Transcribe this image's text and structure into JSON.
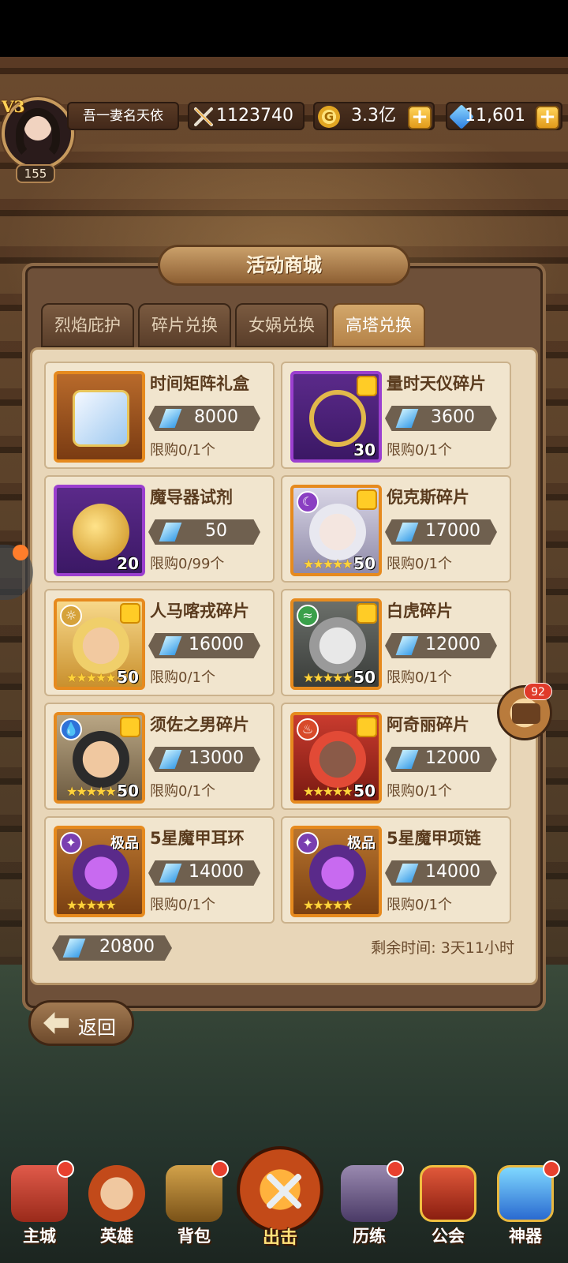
{
  "header": {
    "vip": "V3",
    "level": "155",
    "player_name": "吾一妻名天依",
    "power": "1123740",
    "gold": "3.3亿",
    "gems": "11,601",
    "plus": "+"
  },
  "panel": {
    "title": "活动商城",
    "tabs": [
      {
        "label": "烈焰庇护",
        "active": false
      },
      {
        "label": "碎片兑换",
        "active": false
      },
      {
        "label": "女娲兑换",
        "active": false
      },
      {
        "label": "高塔兑换",
        "active": true
      }
    ],
    "items": [
      {
        "title": "时间矩阵礼盒",
        "price": "8000",
        "limit": "限购0/1个",
        "qty": "",
        "stars": "",
        "quality": ""
      },
      {
        "title": "量时天仪碎片",
        "price": "3600",
        "limit": "限购0/1个",
        "qty": "30",
        "stars": "",
        "quality": ""
      },
      {
        "title": "魔导器试剂",
        "price": "50",
        "limit": "限购0/99个",
        "qty": "20",
        "stars": "",
        "quality": ""
      },
      {
        "title": "倪克斯碎片",
        "price": "17000",
        "limit": "限购0/1个",
        "qty": "50",
        "stars": "★★★★★",
        "quality": ""
      },
      {
        "title": "人马喀戎碎片",
        "price": "16000",
        "limit": "限购0/1个",
        "qty": "50",
        "stars": "★★★★★",
        "quality": ""
      },
      {
        "title": "白虎碎片",
        "price": "12000",
        "limit": "限购0/1个",
        "qty": "50",
        "stars": "★★★★★",
        "quality": ""
      },
      {
        "title": "须佐之男碎片",
        "price": "13000",
        "limit": "限购0/1个",
        "qty": "50",
        "stars": "★★★★★",
        "quality": ""
      },
      {
        "title": "阿奇丽碎片",
        "price": "12000",
        "limit": "限购0/1个",
        "qty": "50",
        "stars": "★★★★★",
        "quality": ""
      },
      {
        "title": "5星魔甲耳环",
        "price": "14000",
        "limit": "限购0/1个",
        "qty": "",
        "stars": "★★★★★",
        "quality": "极品"
      },
      {
        "title": "5星魔甲项链",
        "price": "14000",
        "limit": "限购0/1个",
        "qty": "",
        "stars": "★★★★★",
        "quality": "极品"
      }
    ],
    "balance": "20800",
    "remaining": "剩余时间: 3天11小时"
  },
  "back_button": "返回",
  "chat_badge": "92",
  "nav": {
    "main_city": "主城",
    "heroes": "英雄",
    "bag": "背包",
    "attack": "出击",
    "trial": "历练",
    "guild": "公会",
    "artifact": "神器"
  },
  "icons": {
    "power": "crossed-swords-icon",
    "gold": "gold-coin-icon",
    "gem": "blue-gem-icon",
    "currency": "tower-crystal-icon"
  },
  "colors": {
    "accent_orange": "#e68a1e",
    "rare_purple": "#9b3fcf",
    "panel_bg": "#e8d6b8",
    "title_text": "#5a3b1e",
    "notify_red": "#e8402e"
  }
}
